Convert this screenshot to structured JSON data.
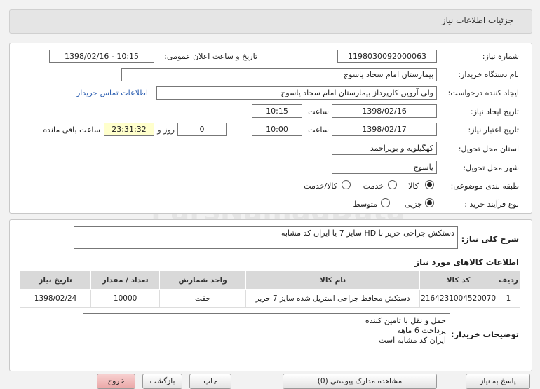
{
  "header": {
    "title": "جزئیات اطلاعات نیاز"
  },
  "fields": {
    "need_number": {
      "label": "شماره نیاز:",
      "value": "1198030092000063"
    },
    "announce": {
      "label": "تاریخ و ساعت اعلان عمومی:",
      "value": "1398/02/16 - 10:15"
    },
    "buyer_org": {
      "label": "نام دستگاه خریدار:",
      "value": "بیمارستان امام سجاد یاسوج"
    },
    "requester": {
      "label": "ایجاد کننده درخواست:",
      "value": "ولی آروین کارپرداز بیمارستان امام سجاد یاسوج"
    },
    "contact_link": "اطلاعات تماس خریدار",
    "created": {
      "label": "تاریخ ایجاد نیاز:",
      "date": "1398/02/16",
      "time_label": "ساعت",
      "time": "10:15"
    },
    "valid": {
      "label": "تاریخ اعتبار نیاز:",
      "date": "1398/02/17",
      "time_label": "ساعت",
      "time": "10:00",
      "days": "0",
      "days_label": "روز و",
      "remaining": "23:31:32",
      "remaining_label": "ساعت باقی مانده"
    },
    "province": {
      "label": "استان محل تحویل:",
      "value": "کهگیلویه و بویراحمد"
    },
    "city": {
      "label": "شهر محل تحویل:",
      "value": "یاسوج"
    },
    "category": {
      "label": "طبقه بندی موضوعی:",
      "options": [
        "کالا",
        "خدمت",
        "کالا/خدمت"
      ]
    },
    "process": {
      "label": "نوع فرآیند خرید :",
      "options": [
        "جزیی",
        "متوسط"
      ]
    }
  },
  "summary": {
    "label": "شرح کلی نیاز:",
    "value": "دستکش جراحی حریر با HD سایز 7 یا ایران کد مشابه"
  },
  "items_section": {
    "title": "اطلاعات کالاهای مورد نیاز",
    "columns": [
      "ردیف",
      "کد کالا",
      "نام کالا",
      "واحد شمارش",
      "تعداد / مقدار",
      "تاریخ نیاز"
    ],
    "rows": [
      [
        "1",
        "2164231004520070",
        "دستکش محافظ جراحی استریل شده سایز 7 حریر",
        "جفت",
        "10000",
        "1398/02/24"
      ]
    ]
  },
  "buyer_notes": {
    "label": "توضیحات خریدار:",
    "lines": [
      "حمل و نقل با تامین کننده",
      "پرداخت 6 ماهه",
      "ایران کد مشابه است"
    ]
  },
  "buttons": {
    "reply": "پاسخ به نیاز",
    "docs": "مشاهده مدارک پیوستی (0)",
    "print": "چاپ",
    "back": "بازگشت",
    "exit": "خروج"
  },
  "watermark": {
    "line1": "ParsNamadData",
    "line2": "پایگاه اطلاع رسانی مناقصه و مزایده"
  }
}
